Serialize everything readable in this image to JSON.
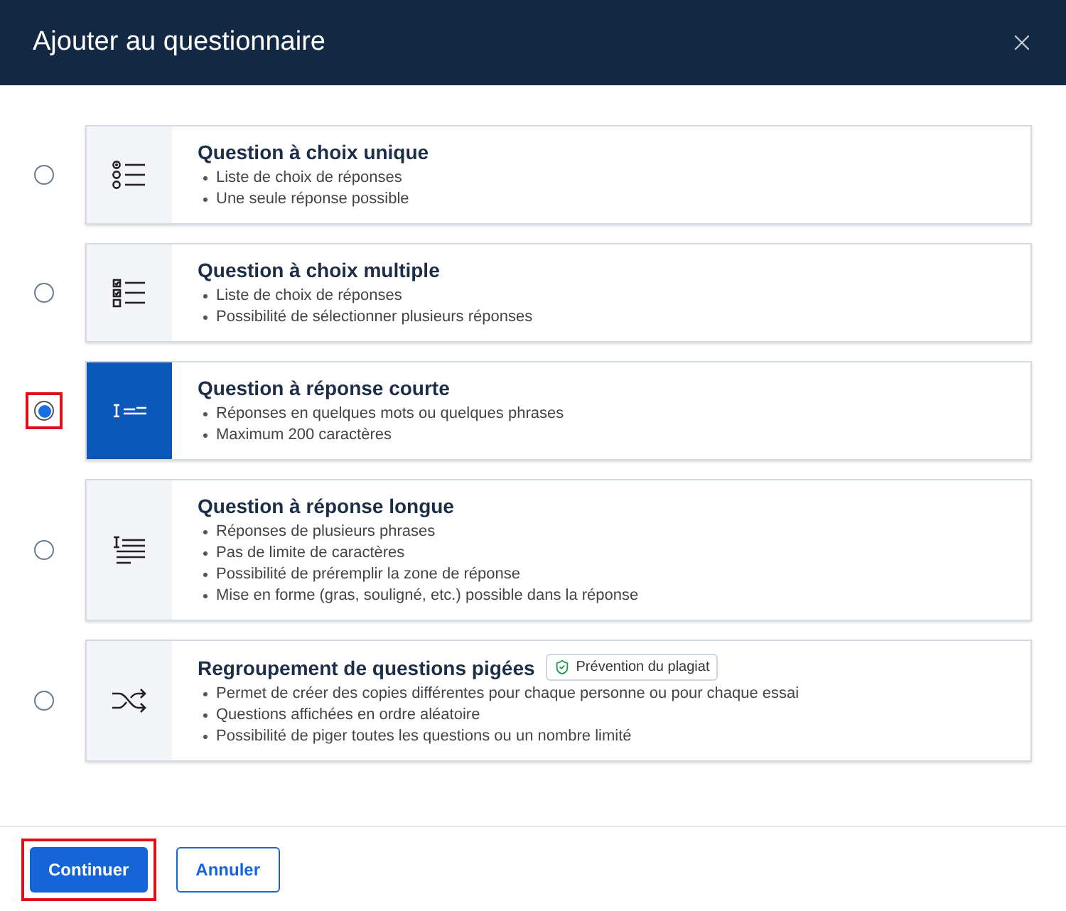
{
  "dialog": {
    "title": "Ajouter au questionnaire"
  },
  "options": [
    {
      "kind": "single",
      "title": "Question à choix unique",
      "selected": false,
      "highlighted": false,
      "bullets": [
        "Liste de choix de réponses",
        "Une seule réponse possible"
      ]
    },
    {
      "kind": "multiple",
      "title": "Question à choix multiple",
      "selected": false,
      "highlighted": false,
      "bullets": [
        "Liste de choix de réponses",
        "Possibilité de sélectionner plusieurs réponses"
      ]
    },
    {
      "kind": "short",
      "title": "Question à réponse courte",
      "selected": true,
      "highlighted": true,
      "bullets": [
        "Réponses en quelques mots ou quelques phrases",
        "Maximum 200 caractères"
      ]
    },
    {
      "kind": "long",
      "title": "Question à réponse longue",
      "selected": false,
      "highlighted": false,
      "bullets": [
        "Réponses de plusieurs phrases",
        "Pas de limite de caractères",
        "Possibilité de préremplir la zone de réponse",
        "Mise en forme (gras, souligné, etc.) possible dans la réponse"
      ]
    },
    {
      "kind": "pool",
      "title": "Regroupement de questions pigées",
      "badge": "Prévention du plagiat",
      "selected": false,
      "highlighted": false,
      "bullets": [
        "Permet de créer des copies différentes pour chaque personne ou pour chaque essai",
        "Questions affichées en ordre aléatoire",
        "Possibilité de piger toutes les questions ou un nombre limité"
      ]
    }
  ],
  "footer": {
    "buttons": [
      {
        "kind": "primary",
        "label": "Continuer",
        "highlighted": true
      },
      {
        "kind": "secondary",
        "label": "Annuler",
        "highlighted": false
      }
    ]
  }
}
